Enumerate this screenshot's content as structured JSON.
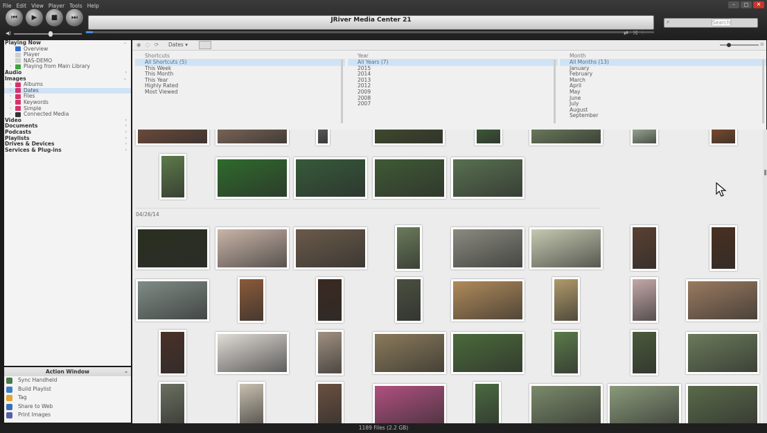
{
  "menu": [
    "File",
    "Edit",
    "View",
    "Player",
    "Tools",
    "Help"
  ],
  "window_buttons": [
    "–",
    "◻",
    "✕"
  ],
  "transport": [
    {
      "name": "prev-track-icon",
      "glyph": "⏮"
    },
    {
      "name": "play-icon",
      "glyph": "▶"
    },
    {
      "name": "stop-icon",
      "glyph": "■"
    },
    {
      "name": "next-track-icon",
      "glyph": "⏭"
    }
  ],
  "title": "JRiver Media Center 21",
  "search": {
    "placeholder": "Search",
    "icon": "⌕"
  },
  "shuffle_controls": "⇄ ⤨ ⫶",
  "volume_icon": "◀)",
  "tree": [
    {
      "label": "Playing Now",
      "type": "head",
      "arrow": "⌄"
    },
    {
      "label": "Overview",
      "type": "sub",
      "color": "#2f6fd1"
    },
    {
      "label": "Player",
      "type": "sub",
      "color": "#cfcfcf"
    },
    {
      "label": "NAS-DEMO",
      "type": "sub",
      "color": "#cfcfcf"
    },
    {
      "label": "Playing from Main Library",
      "type": "sub",
      "color": "#3aa53a",
      "expander": "›"
    },
    {
      "label": "Audio",
      "type": "head",
      "arrow": "›"
    },
    {
      "label": "Images",
      "type": "head",
      "arrow": "⌄"
    },
    {
      "label": "Albums",
      "type": "sub",
      "color": "#d6336c",
      "expander": "›"
    },
    {
      "label": "Dates",
      "type": "sub",
      "color": "#d6336c",
      "expander": "›",
      "selected": true
    },
    {
      "label": "Files",
      "type": "sub",
      "color": "#d6336c",
      "expander": "›"
    },
    {
      "label": "Keywords",
      "type": "sub",
      "color": "#d6336c",
      "expander": "›"
    },
    {
      "label": "Simple",
      "type": "sub",
      "color": "#d6336c",
      "expander": "›"
    },
    {
      "label": "Connected Media",
      "type": "sub",
      "color": "#333333",
      "expander": "›"
    },
    {
      "label": "Video",
      "type": "head",
      "arrow": "›"
    },
    {
      "label": "Documents",
      "type": "head",
      "arrow": "›"
    },
    {
      "label": "Podcasts",
      "type": "head",
      "arrow": "›"
    },
    {
      "label": "Playlists",
      "type": "head",
      "arrow": "›"
    },
    {
      "label": "Drives & Devices",
      "type": "head",
      "arrow": "›"
    },
    {
      "label": "Services & Plug-ins",
      "type": "head",
      "arrow": "›"
    }
  ],
  "action_window": {
    "title": "Action Window",
    "chevron": "⌄",
    "items": [
      {
        "label": "Sync Handheld",
        "color": "#4a7a4a"
      },
      {
        "label": "Build Playlist",
        "color": "#3a7fc8"
      },
      {
        "label": "Tag",
        "color": "#e6a52c"
      },
      {
        "label": "Share to Web",
        "color": "#3d6cb5"
      },
      {
        "label": "Print Images",
        "color": "#5560a8"
      }
    ]
  },
  "browser": {
    "nav_buttons": "◉ ◌ ⟳",
    "view_dropdown": "Dates ▾",
    "zoom_end": "⊘",
    "columns": [
      {
        "header": "Shortcuts",
        "items": [
          "All Shortcuts (5)",
          "This Week",
          "This Month",
          "This Year",
          "Highly Rated",
          "Most Viewed"
        ]
      },
      {
        "header": "Year",
        "items": [
          "All Years (7)",
          "2015",
          "2014",
          "2013",
          "2012",
          "2009",
          "2008",
          "2007"
        ]
      },
      {
        "header": "Month",
        "items": [
          "All Months (13)",
          "January",
          "February",
          "March",
          "April",
          "May",
          "June",
          "July",
          "August",
          "September"
        ]
      }
    ]
  },
  "date_group": "04/26/14",
  "status": "1189 Files (2.2 GB)"
}
